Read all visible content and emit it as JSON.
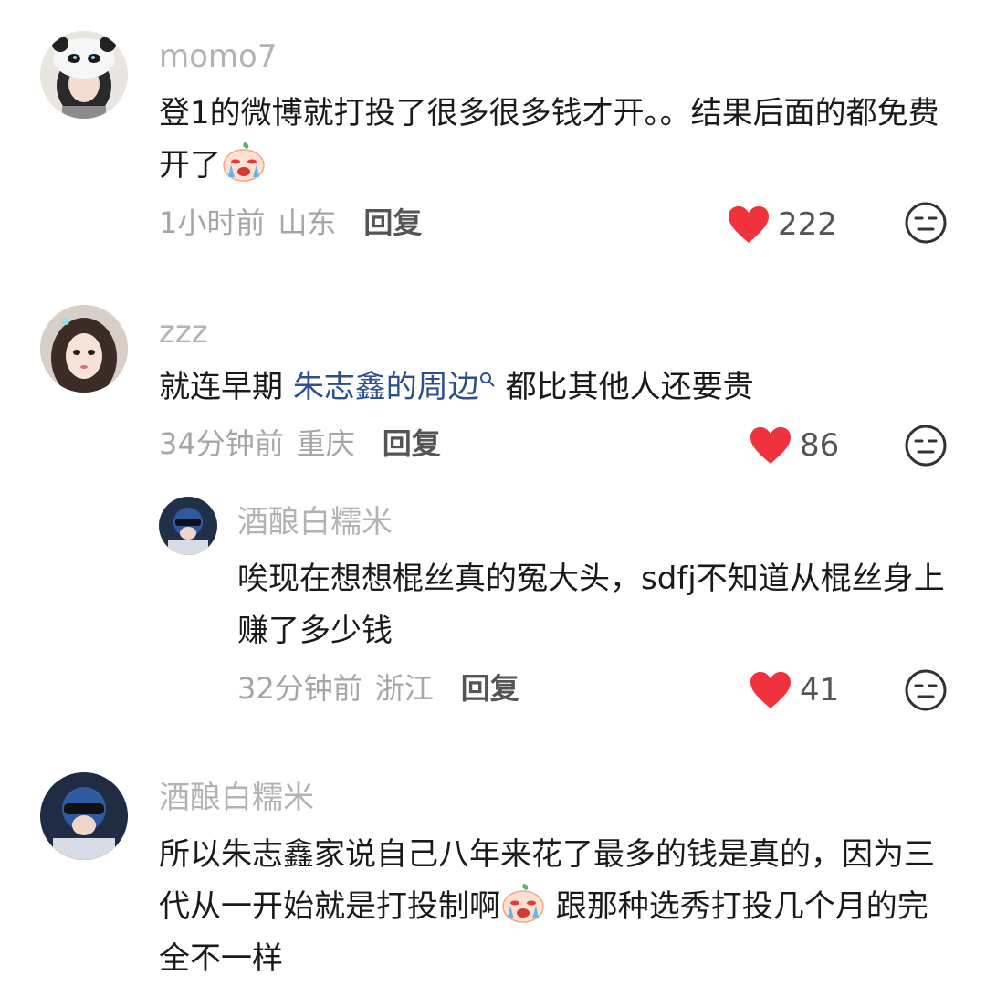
{
  "comments": [
    {
      "username": "momo7",
      "text_before": "登1的微博就打投了很多很多钱才开。。结果后面的都免费开了",
      "time": "1小时前",
      "location": "山东",
      "reply_label": "回复",
      "likes": "222"
    },
    {
      "username": "zzz",
      "text_before": "就连早期 ",
      "link_text": "朱志鑫的周边",
      "text_after": " 都比其他人还要贵",
      "time": "34分钟前",
      "location": "重庆",
      "reply_label": "回复",
      "likes": "86"
    },
    {
      "username": "酒酿白糯米",
      "text_before": "唉现在想想棍丝真的冤大头，sdfj不知道从棍丝身上赚了多少钱",
      "time": "32分钟前",
      "location": "浙江",
      "reply_label": "回复",
      "likes": "41"
    },
    {
      "username": "酒酿白糯米",
      "text_before": "所以朱志鑫家说自己八年来花了最多的钱是真的，因为三代从一开始就是打投制啊",
      "text_after": " 跟那种选秀打投几个月的完全不一样"
    }
  ],
  "colors": {
    "heart": "#f0323c",
    "link": "#2b4f8f"
  },
  "icons": {
    "like": "heart-icon",
    "dislike": "dislike-face-icon",
    "emoji": "crying-emoji-icon",
    "search": "search-icon"
  }
}
